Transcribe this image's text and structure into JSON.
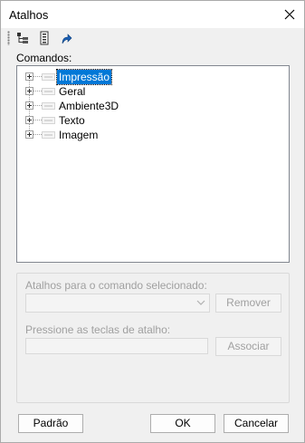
{
  "window": {
    "title": "Atalhos"
  },
  "toolbar": {
    "buttons": [
      {
        "icon": "tree-view-icon"
      },
      {
        "icon": "list-view-icon"
      },
      {
        "icon": "shortcut-arrow-icon"
      }
    ]
  },
  "commands": {
    "label": "Comandos:",
    "items": [
      {
        "label": "Impressão",
        "selected": true
      },
      {
        "label": "Geral",
        "selected": false
      },
      {
        "label": "Ambiente3D",
        "selected": false
      },
      {
        "label": "Texto",
        "selected": false
      },
      {
        "label": "Imagem",
        "selected": false
      }
    ]
  },
  "shortcut_group": {
    "selected_label": "Atalhos para o comando selecionado:",
    "combo_value": "",
    "remove_label": "Remover",
    "press_label": "Pressione as teclas de atalho:",
    "keys_value": "",
    "assign_label": "Associar"
  },
  "footer": {
    "default_label": "Padrão",
    "ok_label": "OK",
    "cancel_label": "Cancelar"
  },
  "colors": {
    "selection": "#0078d7",
    "disabled_text": "#a0a0a0",
    "dialog_bg": "#f0f0f0"
  }
}
